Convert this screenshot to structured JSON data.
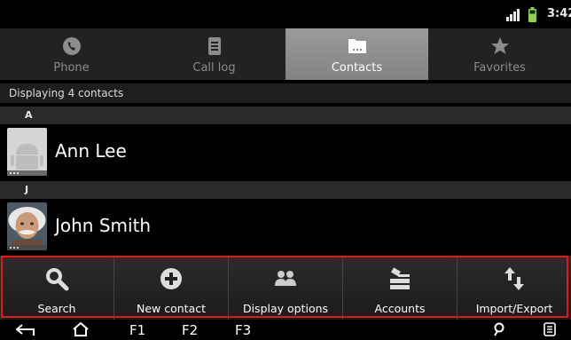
{
  "status_bar": {
    "time": "3:42"
  },
  "tabs": [
    {
      "label": "Phone",
      "icon": "phone-icon"
    },
    {
      "label": "Call log",
      "icon": "call-log-icon"
    },
    {
      "label": "Contacts",
      "icon": "contacts-icon",
      "selected": true
    },
    {
      "label": "Favorites",
      "icon": "star-icon"
    }
  ],
  "list": {
    "status_text": "Displaying 4 contacts",
    "sections": [
      {
        "letter": "A",
        "contact": {
          "name": "Ann Lee",
          "avatar": "default-android-avatar"
        }
      },
      {
        "letter": "J",
        "contact": {
          "name": "John Smith",
          "avatar": "einstein-photo-avatar"
        }
      }
    ]
  },
  "action_bar": {
    "highlight_color": "#e8141b",
    "items": [
      {
        "label": "Search",
        "icon": "search-icon"
      },
      {
        "label": "New contact",
        "icon": "plus-circle-icon"
      },
      {
        "label": "Display options",
        "icon": "people-icon"
      },
      {
        "label": "Accounts",
        "icon": "accounts-icon"
      },
      {
        "label": "Import/Export",
        "icon": "import-export-icon"
      }
    ]
  },
  "system_bar": {
    "keys": [
      "F1",
      "F2",
      "F3"
    ]
  }
}
